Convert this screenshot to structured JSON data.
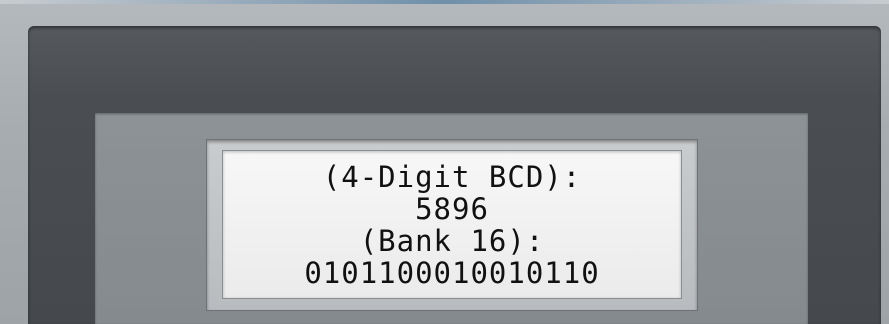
{
  "display": {
    "lines": [
      "(4-Digit BCD):",
      "5896",
      "(Bank 16):",
      "0101100010010110"
    ]
  },
  "colors": {
    "lcd_background": "#f2f2f2",
    "lcd_text": "#111111",
    "bezel_dark": "#4a4e52",
    "panel_light": "#a7acb0"
  }
}
